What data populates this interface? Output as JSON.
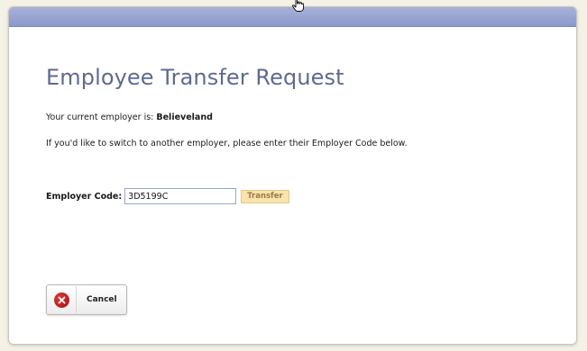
{
  "page": {
    "title": "Employee Transfer Request"
  },
  "employer_info": {
    "prefix": "Your current employer is: ",
    "current_employer": "Believeland"
  },
  "instructions": "If you'd like to switch to another employer, please enter their Employer Code below.",
  "employer_code": {
    "label": "Employer Code:",
    "value": "3D5199C"
  },
  "buttons": {
    "transfer": "Transfer",
    "cancel": "Cancel"
  },
  "icons": {
    "cancel": "close-circle-icon",
    "cursor": "hand-pointer-icon"
  },
  "colors": {
    "titlebar": "#9aa4d4",
    "title_text": "#5f6a8f",
    "transfer_bg": "#fbe3ad",
    "cancel_icon": "#b81d1d"
  }
}
